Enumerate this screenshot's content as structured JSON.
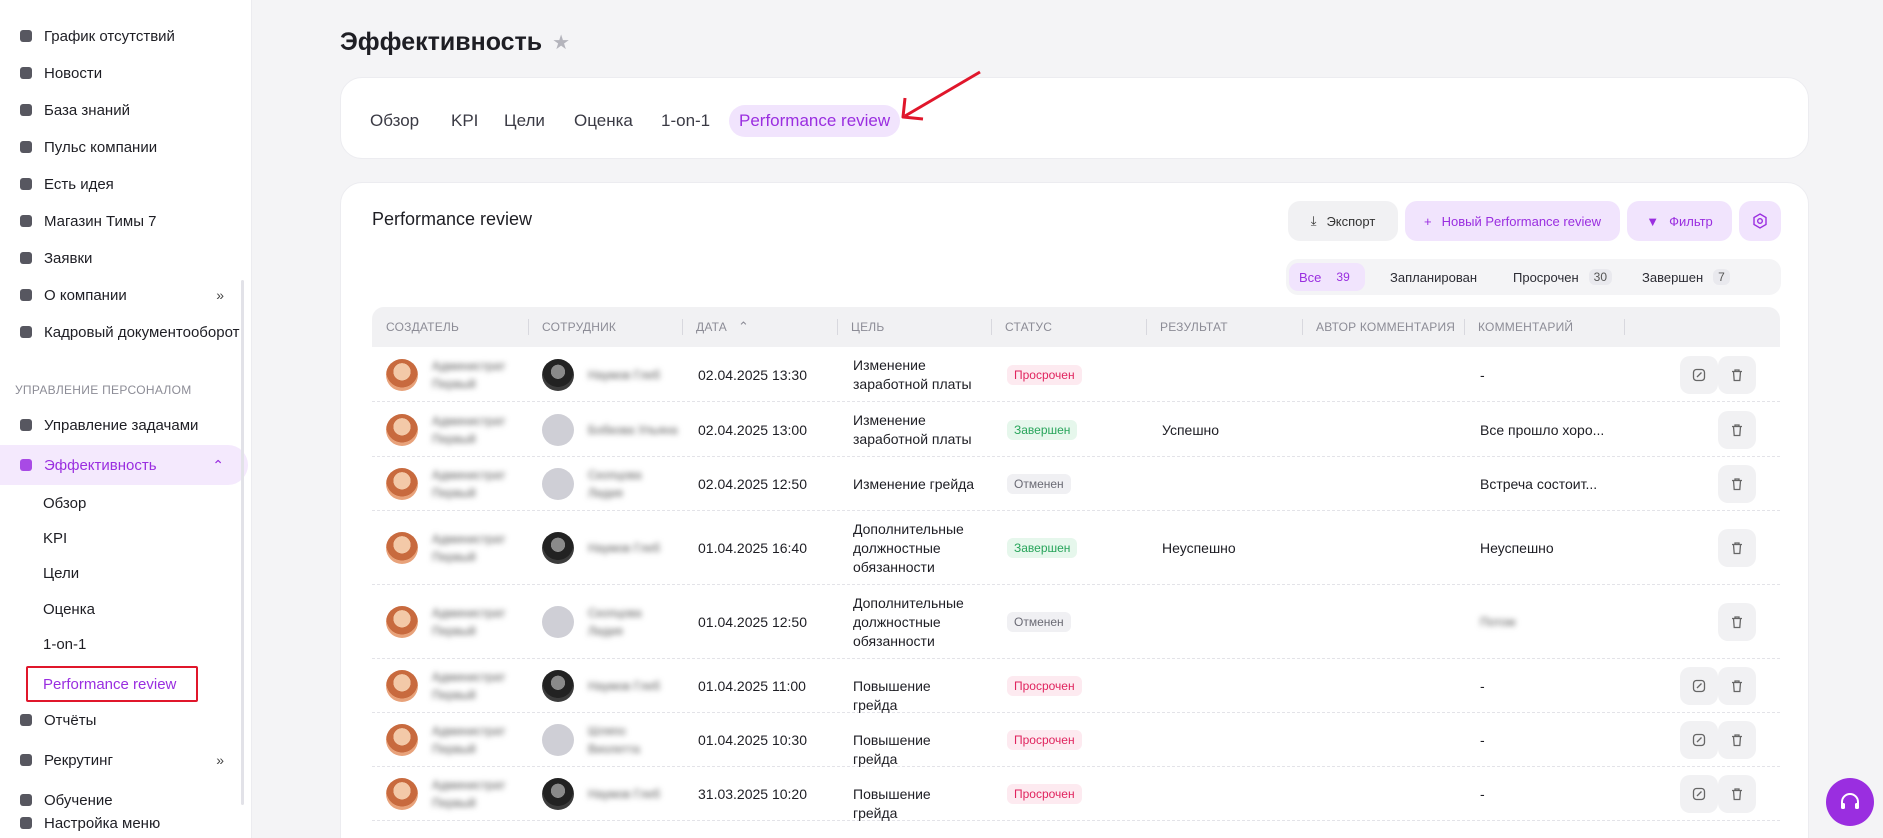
{
  "sidebar": {
    "items": [
      {
        "label": "График отсутствий",
        "icon": "calendar-icon"
      },
      {
        "label": "Новости",
        "icon": "news-icon"
      },
      {
        "label": "База знаний",
        "icon": "bookmark-icon"
      },
      {
        "label": "Пульс компании",
        "icon": "pulse-icon"
      },
      {
        "label": "Есть идея",
        "icon": "bulb-icon"
      },
      {
        "label": "Магазин Тимы 7",
        "icon": "shop-icon"
      },
      {
        "label": "Заявки",
        "icon": "inbox-icon"
      },
      {
        "label": "О компании",
        "icon": "briefcase-icon"
      },
      {
        "label": "Кадровый документооборот",
        "icon": "clipboard-icon"
      }
    ],
    "section_label": "УПРАВЛЕНИЕ ПЕРСОНАЛОМ",
    "items2": [
      {
        "label": "Управление задачами",
        "icon": "tasks-icon"
      },
      {
        "label": "Эффективность",
        "icon": "shield-icon"
      }
    ],
    "sub_items": [
      "Обзор",
      "KPI",
      "Цели",
      "Оценка",
      "1-on-1",
      "Performance review"
    ],
    "items3": [
      {
        "label": "Отчёты",
        "icon": "report-icon"
      },
      {
        "label": "Рекрутинг",
        "icon": "id-card-icon"
      },
      {
        "label": "Обучение",
        "icon": "learning-icon"
      },
      {
        "label": "Настройка меню",
        "icon": "sliders-icon"
      }
    ]
  },
  "page": {
    "title": "Эффективность"
  },
  "tabs": [
    "Обзор",
    "KPI",
    "Цели",
    "Оценка",
    "1-on-1",
    "Performance review"
  ],
  "card": {
    "title": "Performance review",
    "export_label": "Экспорт",
    "new_label": "Новый Performance review",
    "filter_label": "Фильтр"
  },
  "segments": [
    {
      "label": "Все",
      "count": "39"
    },
    {
      "label": "Запланирован",
      "count": ""
    },
    {
      "label": "Просрочен",
      "count": "30"
    },
    {
      "label": "Завершен",
      "count": "7"
    }
  ],
  "columns": [
    "Создатель",
    "Сотрудник",
    "Дата",
    "Цель",
    "Статус",
    "Результат",
    "Автор комментария",
    "Комментарий"
  ],
  "rows": [
    {
      "creator": "Администрат Первый",
      "employee": "Наумов Глеб",
      "emp_avatar": "photo",
      "date": "02.04.2025 13:30",
      "goal": "Изменение заработной платы",
      "status": "Просрочен",
      "status_kind": "overdue",
      "result": "",
      "comment": "-",
      "editable": true
    },
    {
      "creator": "Администрат Первый",
      "employee": "Бобкова Ульяна",
      "emp_avatar": "gray",
      "date": "02.04.2025 13:00",
      "goal": "Изменение заработной платы",
      "status": "Завершен",
      "status_kind": "done",
      "result": "Успешно",
      "comment": "Все прошло хоро...",
      "editable": false
    },
    {
      "creator": "Администрат Первый",
      "employee": "Скопцова Лидия",
      "emp_avatar": "gray",
      "date": "02.04.2025 12:50",
      "goal": "Изменение грейда",
      "status": "Отменен",
      "status_kind": "cancel",
      "result": "",
      "comment": "Встреча состоит...",
      "editable": false
    },
    {
      "creator": "Администрат Первый",
      "employee": "Наумов Глеб",
      "emp_avatar": "photo",
      "date": "01.04.2025 16:40",
      "goal": "Дополнительные должностные обязанности",
      "status": "Завершен",
      "status_kind": "done",
      "result": "Неуспешно",
      "comment": "Неуспешно",
      "editable": false
    },
    {
      "creator": "Администрат Первый",
      "employee": "Скопцова Лидия",
      "emp_avatar": "gray",
      "date": "01.04.2025 12:50",
      "goal": "Дополнительные должностные обязанности",
      "status": "Отменен",
      "status_kind": "cancel",
      "result": "",
      "comment": "Потом",
      "editable": false
    },
    {
      "creator": "Администрат Первый",
      "employee": "Наумов Глеб",
      "emp_avatar": "photo",
      "date": "01.04.2025 11:00",
      "goal": "Повышение грейда",
      "status": "Просрочен",
      "status_kind": "overdue",
      "result": "",
      "comment": "-",
      "editable": true
    },
    {
      "creator": "Администрат Первый",
      "employee": "Шляпо Виолетта",
      "emp_avatar": "gray",
      "date": "01.04.2025 10:30",
      "goal": "Повышение грейда",
      "status": "Просрочен",
      "status_kind": "overdue",
      "result": "",
      "comment": "-",
      "editable": true
    },
    {
      "creator": "Администрат Первый",
      "employee": "Наумов Глеб",
      "emp_avatar": "photo",
      "date": "31.03.2025 10:20",
      "goal": "Повышение грейда",
      "status": "Просрочен",
      "status_kind": "overdue",
      "result": "",
      "comment": "-",
      "editable": true
    }
  ],
  "colors": {
    "accent": "#9a2ee0",
    "highlight_box": "#e0162b"
  }
}
